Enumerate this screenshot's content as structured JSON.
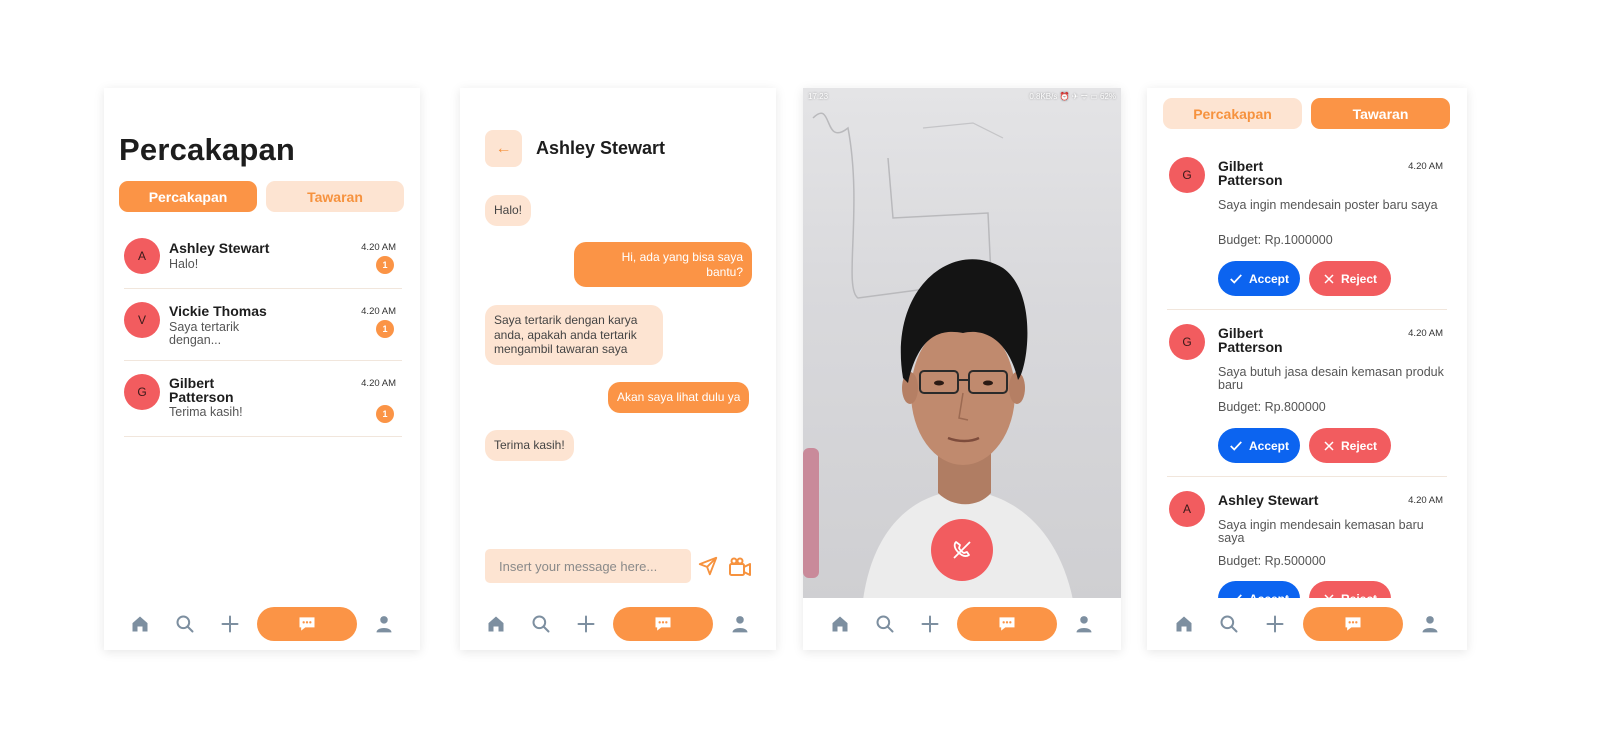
{
  "nav": {
    "icons": [
      "home-icon",
      "search-icon",
      "plus-icon",
      "chat-icon",
      "profile-icon"
    ],
    "accent": "#fb9446"
  },
  "screen1": {
    "title": "Percakapan",
    "tabs": {
      "active": "Percakapan",
      "inactive": "Tawaran"
    },
    "conversations": [
      {
        "initial": "A",
        "name": "Ashley Stewart",
        "message": "Halo!",
        "time": "4.20 AM",
        "unread": "1"
      },
      {
        "initial": "V",
        "name": "Vickie Thomas",
        "message": "Saya tertarik dengan...",
        "time": "4.20 AM",
        "unread": "1"
      },
      {
        "initial": "G",
        "name": "Gilbert Patterson",
        "message": "Terima kasih!",
        "time": "4.20 AM",
        "unread": "1"
      }
    ]
  },
  "screen2": {
    "back_icon": "←",
    "contact": "Ashley Stewart",
    "messages": [
      {
        "dir": "in",
        "text": "Halo!"
      },
      {
        "dir": "out",
        "text": "Hi, ada yang bisa saya bantu?"
      },
      {
        "dir": "in",
        "text": "Saya tertarik dengan karya anda, apakah anda tertarik mengambil tawaran saya"
      },
      {
        "dir": "out",
        "text": "Akan saya lihat dulu ya"
      },
      {
        "dir": "in",
        "text": "Terima kasih!"
      }
    ],
    "input_placeholder": "Insert your message here..."
  },
  "screen3": {
    "status_time": "17:23",
    "status_right": "0.8KB/s ⏰ ✈ ᯤ ▭ 62%",
    "hangup_color": "#f25c5f"
  },
  "screen4": {
    "tabs": {
      "inactive": "Percakapan",
      "active": "Tawaran"
    },
    "offers": [
      {
        "initial": "G",
        "name": "Gilbert Patterson",
        "time": "4.20 AM",
        "desc": "Saya ingin mendesain poster baru saya",
        "budget": "Budget: Rp.1000000",
        "accept": "Accept",
        "reject": "Reject"
      },
      {
        "initial": "G",
        "name": "Gilbert Patterson",
        "time": "4.20 AM",
        "desc": "Saya butuh jasa desain kemasan produk baru",
        "budget": "Budget: Rp.800000",
        "accept": "Accept",
        "reject": "Reject"
      },
      {
        "initial": "A",
        "name": "Ashley Stewart",
        "time": "4.20 AM",
        "desc": "Saya ingin mendesain kemasan baru saya",
        "budget": "Budget: Rp.500000",
        "accept": "Accept",
        "reject": "Reject"
      }
    ]
  }
}
